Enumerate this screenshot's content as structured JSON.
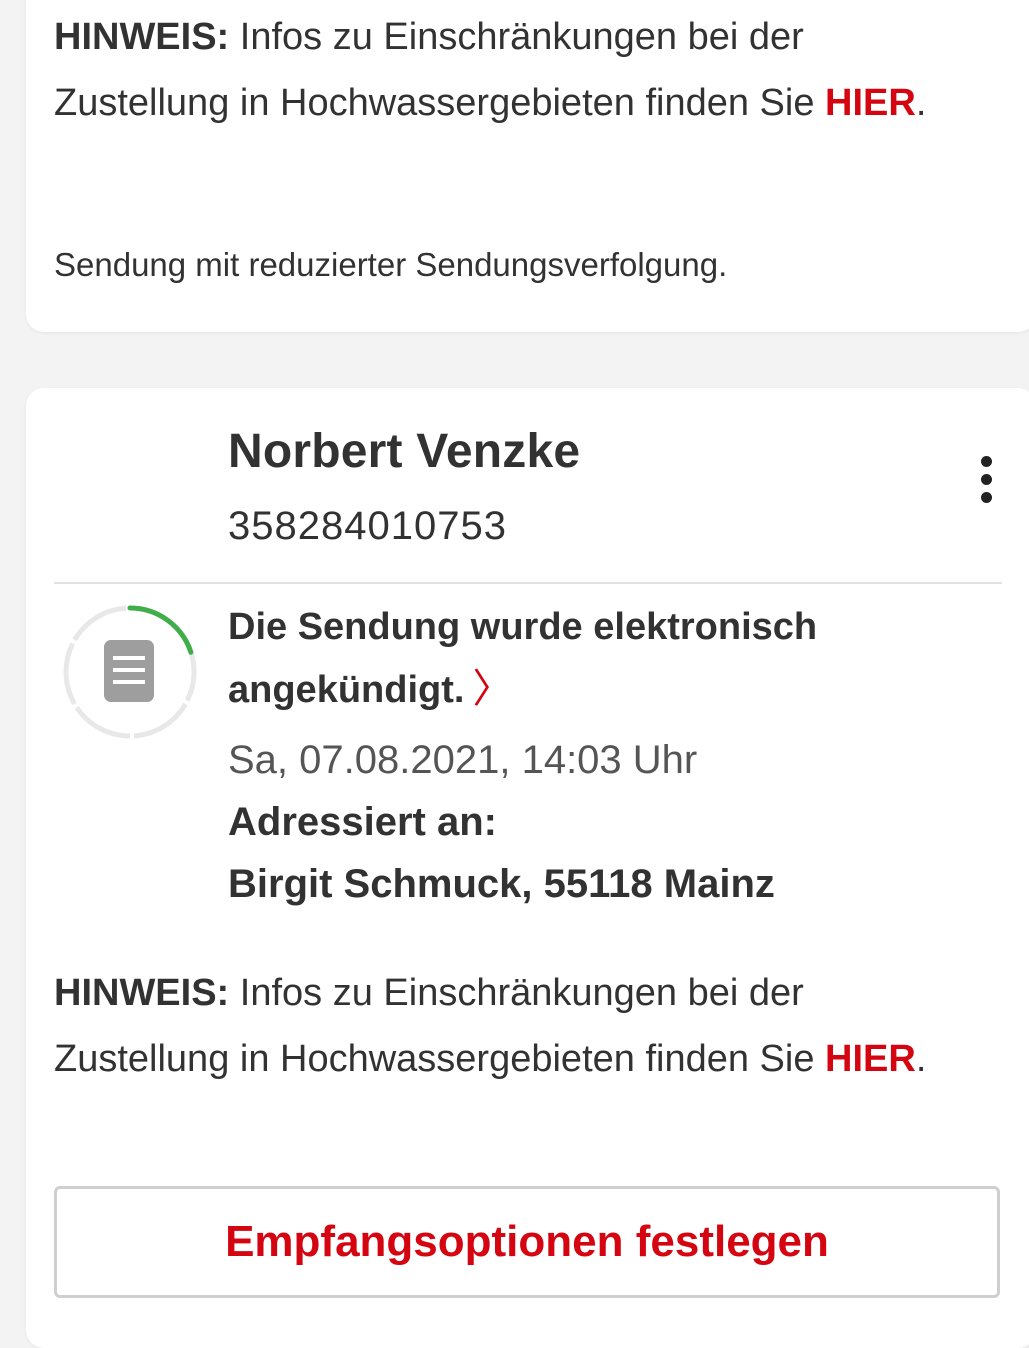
{
  "notice_top": {
    "label": "HINWEIS:",
    "text": " Infos zu Einschränkungen bei der Zustellung in Hochwassergebieten finden Sie ",
    "link": "HIER",
    "after": "."
  },
  "reduced_tracking_note": "Sendung mit reduzierter Sendungsverfolgung.",
  "shipment": {
    "recipient_name": "Norbert Venzke",
    "tracking_number": "358284010753",
    "status": {
      "headline": "Die Sendung wurde elektronisch angekündigt.",
      "chevron": "〉",
      "date": "Sa, 07.08.2021, 14:03 Uhr",
      "addressed_label": "Adressiert an:",
      "addressed_value": "Birgit Schmuck, 55118 Mainz",
      "progress": 0.2
    },
    "notice": {
      "label": "HINWEIS:",
      "text": " Infos zu Einschränkungen bei der Zustellung in Hochwassergebieten finden Sie ",
      "link": "HIER",
      "after": "."
    },
    "action_button": "Empfangsoptionen festlegen"
  },
  "colors": {
    "brand_red": "#d40511",
    "progress_green": "#3fae49",
    "track_grey": "#e8e8e8",
    "icon_grey": "#9e9e9e"
  },
  "icons": {
    "status_icon": "document-icon",
    "menu_icon": "more-vertical-icon"
  }
}
